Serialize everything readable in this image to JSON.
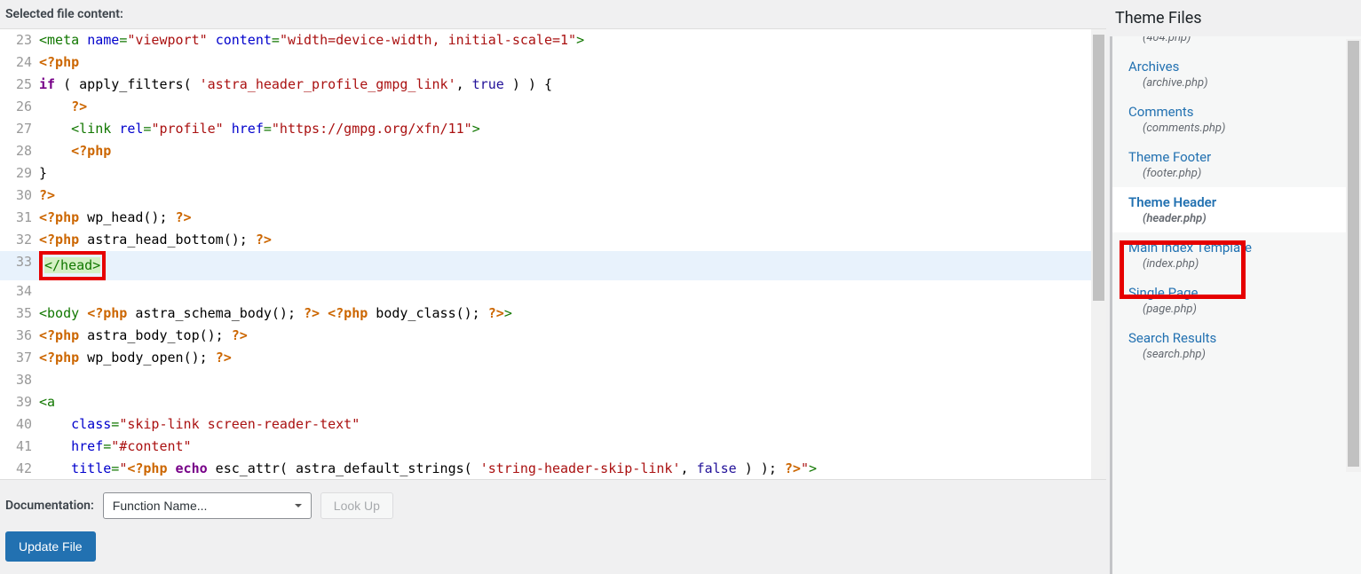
{
  "labels": {
    "selected_content": "Selected file content:",
    "theme_files": "Theme Files",
    "documentation": "Documentation:",
    "select_placeholder": "Function Name...",
    "lookup": "Look Up",
    "update": "Update File"
  },
  "code": {
    "line_23": {
      "num": "23",
      "tokens": [
        [
          "tag",
          "<meta "
        ],
        [
          "attr",
          "name"
        ],
        [
          "tag",
          "="
        ],
        [
          "str",
          "\"viewport\""
        ],
        [
          "tag",
          " "
        ],
        [
          "attr",
          "content"
        ],
        [
          "tag",
          "="
        ],
        [
          "str",
          "\"width=device-width, initial-scale=1\""
        ],
        [
          "tag",
          ">"
        ]
      ]
    },
    "line_24": {
      "num": "24",
      "tokens": [
        [
          "php-open",
          "<?php"
        ]
      ]
    },
    "line_25": {
      "num": "25",
      "tokens": [
        [
          "kw",
          "if"
        ],
        [
          "paren",
          " ( "
        ],
        [
          "fn",
          "apply_filters"
        ],
        [
          "paren",
          "( "
        ],
        [
          "str",
          "'astra_header_profile_gmpg_link'"
        ],
        [
          "paren",
          ", "
        ],
        [
          "bool",
          "true"
        ],
        [
          "paren",
          " ) ) {"
        ]
      ]
    },
    "line_26": {
      "num": "26",
      "tokens": [
        [
          "paren",
          "    "
        ],
        [
          "php-open",
          "?>"
        ]
      ]
    },
    "line_27": {
      "num": "27",
      "tokens": [
        [
          "paren",
          "    "
        ],
        [
          "tag",
          "<link "
        ],
        [
          "attr",
          "rel"
        ],
        [
          "tag",
          "="
        ],
        [
          "str",
          "\"profile\""
        ],
        [
          "tag",
          " "
        ],
        [
          "attr",
          "href"
        ],
        [
          "tag",
          "="
        ],
        [
          "str",
          "\"https://gmpg.org/xfn/11\""
        ],
        [
          "tag",
          ">"
        ]
      ]
    },
    "line_28": {
      "num": "28",
      "tokens": [
        [
          "paren",
          "    "
        ],
        [
          "php-open",
          "<?php"
        ]
      ]
    },
    "line_29": {
      "num": "29",
      "tokens": [
        [
          "paren",
          "}"
        ]
      ]
    },
    "line_30": {
      "num": "30",
      "tokens": [
        [
          "php-open",
          "?>"
        ]
      ]
    },
    "line_31": {
      "num": "31",
      "tokens": [
        [
          "php-open",
          "<?php"
        ],
        [
          "fn",
          " wp_head"
        ],
        [
          "paren",
          "(); "
        ],
        [
          "php-open",
          "?>"
        ]
      ]
    },
    "line_32": {
      "num": "32",
      "tokens": [
        [
          "php-open",
          "<?php"
        ],
        [
          "fn",
          " astra_head_bottom"
        ],
        [
          "paren",
          "(); "
        ],
        [
          "php-open",
          "?>"
        ]
      ]
    },
    "line_33": {
      "num": "33",
      "highlighted": true,
      "red_box": true,
      "close_hl": true,
      "tokens": [
        [
          "tag",
          "</head>"
        ]
      ]
    },
    "line_34": {
      "num": "34",
      "tokens": []
    },
    "line_35": {
      "num": "35",
      "tokens": [
        [
          "tag",
          "<body "
        ],
        [
          "php-open",
          "<?php"
        ],
        [
          "fn",
          " astra_schema_body"
        ],
        [
          "paren",
          "(); "
        ],
        [
          "php-open",
          "?>"
        ],
        [
          "tag",
          " "
        ],
        [
          "php-open",
          "<?php"
        ],
        [
          "fn",
          " body_class"
        ],
        [
          "paren",
          "(); "
        ],
        [
          "php-open",
          "?>"
        ],
        [
          "tag",
          ">"
        ]
      ]
    },
    "line_36": {
      "num": "36",
      "tokens": [
        [
          "php-open",
          "<?php"
        ],
        [
          "fn",
          " astra_body_top"
        ],
        [
          "paren",
          "(); "
        ],
        [
          "php-open",
          "?>"
        ]
      ]
    },
    "line_37": {
      "num": "37",
      "tokens": [
        [
          "php-open",
          "<?php"
        ],
        [
          "fn",
          " wp_body_open"
        ],
        [
          "paren",
          "(); "
        ],
        [
          "php-open",
          "?>"
        ]
      ]
    },
    "line_38": {
      "num": "38",
      "tokens": []
    },
    "line_39": {
      "num": "39",
      "tokens": [
        [
          "tag",
          "<a"
        ]
      ]
    },
    "line_40": {
      "num": "40",
      "tokens": [
        [
          "paren",
          "    "
        ],
        [
          "attr",
          "class"
        ],
        [
          "tag",
          "="
        ],
        [
          "str",
          "\"skip-link screen-reader-text\""
        ]
      ]
    },
    "line_41": {
      "num": "41",
      "tokens": [
        [
          "paren",
          "    "
        ],
        [
          "attr",
          "href"
        ],
        [
          "tag",
          "="
        ],
        [
          "str",
          "\"#content\""
        ]
      ]
    },
    "line_42": {
      "num": "42",
      "tokens": [
        [
          "paren",
          "    "
        ],
        [
          "attr",
          "title"
        ],
        [
          "tag",
          "="
        ],
        [
          "str",
          "\""
        ],
        [
          "php-open",
          "<?php"
        ],
        [
          "kw",
          " echo"
        ],
        [
          "fn",
          " esc_attr"
        ],
        [
          "paren",
          "( "
        ],
        [
          "fn",
          "astra_default_strings"
        ],
        [
          "paren",
          "( "
        ],
        [
          "str",
          "'string-header-skip-link'"
        ],
        [
          "paren",
          ", "
        ],
        [
          "bool",
          "false"
        ],
        [
          "paren",
          " ) ); "
        ],
        [
          "php-open",
          "?>"
        ],
        [
          "str",
          "\""
        ],
        [
          "tag",
          ">"
        ]
      ]
    }
  },
  "files": [
    {
      "name": "",
      "file": "(404.php)",
      "active": false,
      "indent_only": true
    },
    {
      "name": "Archives",
      "file": "(archive.php)",
      "active": false
    },
    {
      "name": "Comments",
      "file": "(comments.php)",
      "active": false
    },
    {
      "name": "Theme Footer",
      "file": "(footer.php)",
      "active": false
    },
    {
      "name": "Theme Header",
      "file": "(header.php)",
      "active": true
    },
    {
      "name": "Main Index Template",
      "file": "(index.php)",
      "active": false
    },
    {
      "name": "Single Page",
      "file": "(page.php)",
      "active": false
    },
    {
      "name": "Search Results",
      "file": "(search.php)",
      "active": false
    }
  ]
}
